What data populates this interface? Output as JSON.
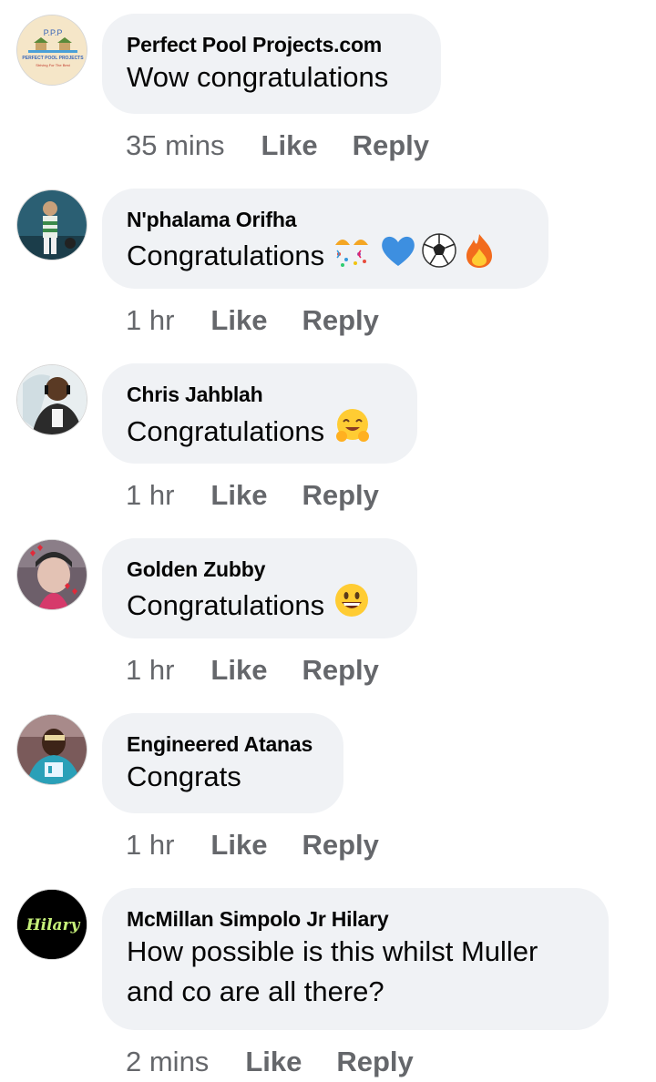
{
  "comments": [
    {
      "author": "Perfect Pool Projects.com",
      "text": "Wow congratulations",
      "time": "35 mins",
      "like": "Like",
      "reply": "Reply",
      "avatar_text": "P.P.P",
      "avatar_subtext": "PERFECT POOL PROJECTS",
      "avatar_tagline": "Striving For The Best"
    },
    {
      "author": "N'phalama Orifha",
      "text": "Congratulations",
      "emojis": [
        "party-popper",
        "blue-heart",
        "soccer-ball",
        "fire"
      ],
      "time": "1 hr",
      "like": "Like",
      "reply": "Reply"
    },
    {
      "author": "Chris Jahblah",
      "text": "Congratulations",
      "emojis": [
        "hugging-face"
      ],
      "time": "1 hr",
      "like": "Like",
      "reply": "Reply"
    },
    {
      "author": "Golden Zubby",
      "text": "Congratulations",
      "emojis": [
        "grinning-face"
      ],
      "time": "1 hr",
      "like": "Like",
      "reply": "Reply"
    },
    {
      "author": "Engineered Atanas",
      "text": "Congrats",
      "time": "1 hr",
      "like": "Like",
      "reply": "Reply"
    },
    {
      "author": "McMillan Simpolo Jr Hilary",
      "text_line1": "How possible is this whilst Muller",
      "text_line2": "and co are all there?",
      "time": "2 mins",
      "like": "Like",
      "reply": "Reply",
      "avatar_text": "Hilary"
    }
  ],
  "colors": {
    "bubble": "#f0f2f5",
    "meta": "#65676b",
    "text": "#050505"
  }
}
